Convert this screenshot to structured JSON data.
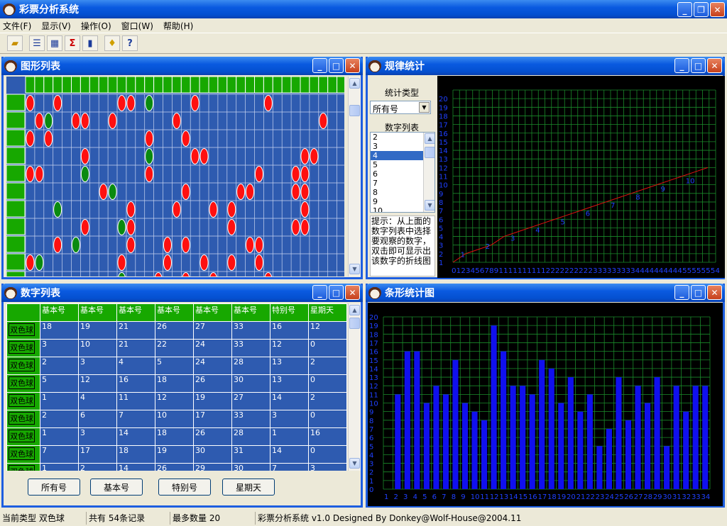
{
  "app": {
    "title": "彩票分析系统"
  },
  "menu": [
    "文件(F)",
    "显示(V)",
    "操作(O)",
    "窗口(W)",
    "帮助(H)"
  ],
  "toolbar": [
    "open",
    "list",
    "grid",
    "Σ",
    "chart",
    "tip",
    "help"
  ],
  "win_graph": {
    "title": "图形列表"
  },
  "win_rule": {
    "title": "规律统计",
    "stat_type_label": "统计类型",
    "stat_type_value": "所有号",
    "num_list_label": "数字列表",
    "numbers": [
      "2",
      "3",
      "4",
      "5",
      "6",
      "7",
      "8",
      "9",
      "10"
    ],
    "selected": "4",
    "hint": "提示：从上面的数字列表中选择要观察的数字，双击即可显示出该数字的折线图"
  },
  "win_num": {
    "title": "数字列表",
    "headers": [
      "基本号",
      "基本号",
      "基本号",
      "基本号",
      "基本号",
      "基本号",
      "特别号",
      "星期天"
    ],
    "row_label": "双色球",
    "rows": [
      [
        "18",
        "19",
        "21",
        "26",
        "27",
        "33",
        "16",
        "12"
      ],
      [
        "3",
        "10",
        "21",
        "22",
        "24",
        "33",
        "12",
        "0"
      ],
      [
        "2",
        "3",
        "4",
        "5",
        "24",
        "28",
        "13",
        "2"
      ],
      [
        "5",
        "12",
        "16",
        "18",
        "26",
        "30",
        "13",
        "0"
      ],
      [
        "1",
        "4",
        "11",
        "12",
        "19",
        "27",
        "14",
        "2"
      ],
      [
        "2",
        "6",
        "7",
        "10",
        "17",
        "33",
        "3",
        "0"
      ],
      [
        "1",
        "3",
        "14",
        "18",
        "26",
        "28",
        "1",
        "16"
      ],
      [
        "7",
        "17",
        "18",
        "19",
        "30",
        "31",
        "14",
        "0"
      ],
      [
        "1",
        "2",
        "14",
        "26",
        "29",
        "30",
        "7",
        "3"
      ]
    ],
    "buttons": [
      "所有号",
      "基本号",
      "特别号",
      "星期天"
    ]
  },
  "win_bar": {
    "title": "条形统计图"
  },
  "chart_data": [
    {
      "type": "line",
      "title": "规律统计",
      "y_ticks": [
        "1",
        "2",
        "3",
        "4",
        "5",
        "6",
        "7",
        "8",
        "9",
        "10",
        "11",
        "12",
        "13",
        "14",
        "15",
        "16",
        "17",
        "18",
        "19",
        "20"
      ],
      "x_ticks": "012345678911111111112222222222333333333444444444455555554",
      "point_labels": [
        "1",
        "2",
        "3",
        "4",
        "5",
        "6",
        "7",
        "8",
        "9",
        "10"
      ],
      "values": [
        0,
        1,
        1.5,
        2,
        3,
        3.5,
        4,
        4.5,
        5,
        5.5,
        6,
        6.5,
        7,
        7.5,
        8,
        8.5,
        9,
        9.5,
        10,
        10.5,
        11
      ],
      "ylim": [
        0,
        20
      ]
    },
    {
      "type": "bar",
      "title": "条形统计图",
      "categories": [
        "1",
        "2",
        "3",
        "4",
        "5",
        "6",
        "7",
        "8",
        "9",
        "10",
        "11",
        "12",
        "13",
        "14",
        "15",
        "16",
        "17",
        "18",
        "19",
        "20",
        "21",
        "22",
        "23",
        "24",
        "25",
        "26",
        "27",
        "28",
        "29",
        "30",
        "31",
        "32",
        "33",
        "34"
      ],
      "values": [
        0,
        11,
        16,
        16,
        10,
        12,
        11,
        15,
        10,
        9,
        8,
        19,
        16,
        12,
        12,
        11,
        15,
        14,
        10,
        13,
        9,
        11,
        5,
        7,
        13,
        8,
        12,
        10,
        13,
        5,
        12,
        9,
        12,
        12
      ],
      "ylim": [
        0,
        20
      ]
    }
  ],
  "status": [
    "当前类型 双色球",
    "共有 54条记录",
    "最多数量 20",
    "彩票分析系统 v1.0 Designed By Donkey@Wolf-House@2004.11"
  ],
  "colors": {
    "red": "#ff1010",
    "green": "#0a8a10",
    "grid_bg": "#2e5bb0",
    "chart_bg": "#000000",
    "grid_line": "#1a8a2a",
    "bar": "#1010ee"
  }
}
